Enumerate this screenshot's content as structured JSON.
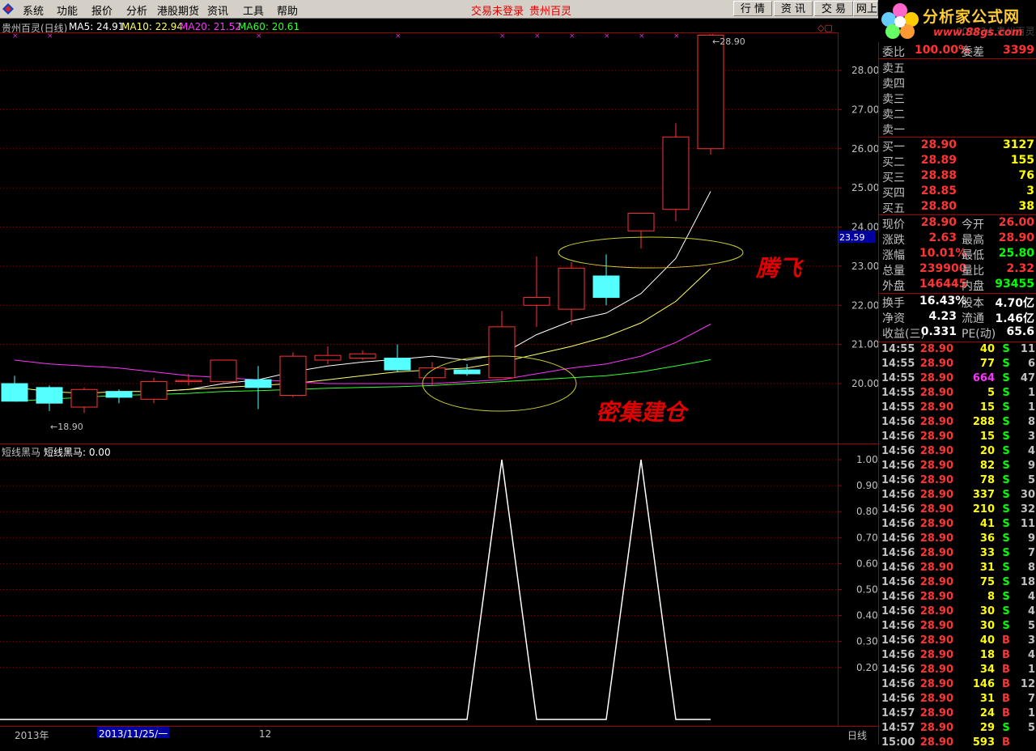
{
  "menu": {
    "items": [
      "系统",
      "功能",
      "报价",
      "分析",
      "港股期货",
      "资讯",
      "工具",
      "帮助"
    ],
    "status_login": "交易未登录",
    "status_stock": "贵州百灵",
    "buttons": [
      "行 情",
      "资 讯",
      "交 易",
      "网上"
    ]
  },
  "brand": {
    "title": "分析家公式网",
    "url": "www.88gs.com",
    "behind_text": "002424 贵州百灵"
  },
  "legend": {
    "name": "贵州百灵(日线)",
    "ma5": "MA5: 24.91",
    "ma10": "MA10: 22.94",
    "ma20": "MA20: 21.52",
    "ma60": "MA60: 20.61",
    "ma5_color": "#ffffff",
    "ma10_color": "#ffff66",
    "ma20_color": "#ff33ff",
    "ma60_color": "#33ff33"
  },
  "indicator": {
    "name": "短线黑马",
    "value_text": "短线黑马: 0.00"
  },
  "price_axis": {
    "ticks": [
      "28.00",
      "27.00",
      "26.00",
      "25.00",
      "24.00",
      "23.00",
      "22.00",
      "21.00",
      "20.00"
    ],
    "current_label": "23.59"
  },
  "indicator_axis": {
    "ticks": [
      "1.00",
      "0.90",
      "0.80",
      "0.70",
      "0.60",
      "0.50",
      "0.40",
      "0.30",
      "0.20"
    ]
  },
  "chart_annotations": {
    "high_label": "28.90",
    "low_label": "18.90",
    "tengfei": "腾飞",
    "mijijiancang": "密集建仓"
  },
  "chart_data": [
    {
      "type": "candlestick",
      "title": "贵州百灵(日线)",
      "ylim": [
        18.9,
        28.9
      ],
      "candles": [
        {
          "o": 20.0,
          "h": 20.2,
          "l": 19.55,
          "c": 19.55
        },
        {
          "o": 19.9,
          "h": 19.95,
          "l": 19.3,
          "c": 19.5
        },
        {
          "o": 19.4,
          "h": 19.9,
          "l": 19.25,
          "c": 19.85
        },
        {
          "o": 19.8,
          "h": 19.85,
          "l": 19.5,
          "c": 19.65
        },
        {
          "o": 19.6,
          "h": 20.15,
          "l": 19.5,
          "c": 20.05
        },
        {
          "o": 20.05,
          "h": 20.25,
          "l": 19.95,
          "c": 20.08
        },
        {
          "o": 20.05,
          "h": 20.6,
          "l": 20.0,
          "c": 20.6
        },
        {
          "o": 20.1,
          "h": 20.45,
          "l": 19.35,
          "c": 19.9
        },
        {
          "o": 19.7,
          "h": 20.8,
          "l": 19.65,
          "c": 20.7
        },
        {
          "o": 20.6,
          "h": 20.95,
          "l": 20.5,
          "c": 20.72
        },
        {
          "o": 20.65,
          "h": 20.85,
          "l": 20.6,
          "c": 20.76
        },
        {
          "o": 20.65,
          "h": 21.0,
          "l": 20.3,
          "c": 20.35
        },
        {
          "o": 20.15,
          "h": 20.55,
          "l": 19.95,
          "c": 20.4
        },
        {
          "o": 20.35,
          "h": 20.5,
          "l": 20.2,
          "c": 20.25
        },
        {
          "o": 20.15,
          "h": 21.85,
          "l": 20.15,
          "c": 21.45
        },
        {
          "o": 22.0,
          "h": 23.25,
          "l": 21.45,
          "c": 22.2
        },
        {
          "o": 21.9,
          "h": 23.1,
          "l": 21.5,
          "c": 22.95
        },
        {
          "o": 22.75,
          "h": 23.3,
          "l": 22.0,
          "c": 22.2
        },
        {
          "o": 23.9,
          "h": 24.35,
          "l": 23.45,
          "c": 24.35
        },
        {
          "o": 24.45,
          "h": 26.65,
          "l": 24.15,
          "c": 26.3
        },
        {
          "o": 26.0,
          "h": 28.9,
          "l": 25.85,
          "c": 28.9
        }
      ],
      "series": [
        {
          "name": "MA5",
          "values": [
            null,
            null,
            null,
            null,
            19.8,
            19.85,
            20.0,
            20.1,
            20.3,
            20.45,
            20.55,
            20.62,
            20.7,
            20.6,
            20.75,
            21.25,
            21.6,
            21.8,
            22.3,
            23.2,
            24.91
          ]
        },
        {
          "name": "MA10",
          "values": [
            19.9,
            19.8,
            19.75,
            19.8,
            19.8,
            19.85,
            19.9,
            19.95,
            20.0,
            20.1,
            20.2,
            20.3,
            20.35,
            20.4,
            20.55,
            20.75,
            20.95,
            21.2,
            21.55,
            22.1,
            22.94
          ]
        },
        {
          "name": "MA20",
          "values": [
            20.6,
            20.5,
            20.45,
            20.4,
            20.3,
            20.2,
            20.15,
            20.1,
            20.05,
            20.0,
            20.0,
            20.0,
            20.0,
            20.05,
            20.1,
            20.25,
            20.4,
            20.5,
            20.7,
            21.05,
            21.52
          ]
        },
        {
          "name": "MA60",
          "values": [
            19.55,
            19.6,
            19.65,
            19.7,
            19.72,
            19.75,
            19.8,
            19.82,
            19.85,
            19.88,
            19.9,
            19.92,
            19.95,
            20.0,
            20.05,
            20.1,
            20.15,
            20.2,
            20.3,
            20.45,
            20.61
          ]
        }
      ]
    },
    {
      "type": "line",
      "title": "短线黑马",
      "ylim": [
        0,
        1
      ],
      "series": [
        {
          "values": [
            0,
            0,
            0,
            0,
            0,
            0,
            0,
            0,
            0,
            0,
            0,
            0,
            0,
            0,
            1,
            0,
            0,
            0,
            1,
            0,
            0
          ]
        }
      ]
    }
  ],
  "bottom": {
    "year": "2013年",
    "date": "2013/11/25/一",
    "month": "12",
    "period": "日线"
  },
  "quote": {
    "weibi_label": "委比",
    "weibi_value": "100.00%",
    "weicha_label": "委差",
    "weicha_value": "3399",
    "sell": [
      {
        "label": "卖五",
        "price": "",
        "vol": ""
      },
      {
        "label": "卖四",
        "price": "",
        "vol": ""
      },
      {
        "label": "卖三",
        "price": "",
        "vol": ""
      },
      {
        "label": "卖二",
        "price": "",
        "vol": ""
      },
      {
        "label": "卖一",
        "price": "",
        "vol": ""
      }
    ],
    "buy": [
      {
        "label": "买一",
        "price": "28.90",
        "vol": "3127"
      },
      {
        "label": "买二",
        "price": "28.89",
        "vol": "155"
      },
      {
        "label": "买三",
        "price": "28.88",
        "vol": "76"
      },
      {
        "label": "买四",
        "price": "28.85",
        "vol": "3"
      },
      {
        "label": "买五",
        "price": "28.80",
        "vol": "38"
      }
    ],
    "stats": [
      {
        "l1": "现价",
        "v1": "28.90",
        "l2": "今开",
        "v2": "26.00",
        "c2": "#ff3333"
      },
      {
        "l1": "涨跌",
        "v1": "2.63",
        "l2": "最高",
        "v2": "28.90",
        "c2": "#ff3333"
      },
      {
        "l1": "涨幅",
        "v1": "10.01%",
        "l2": "最低",
        "v2": "25.80",
        "c2": "#00ff00"
      },
      {
        "l1": "总量",
        "v1": "239900",
        "l2": "量比",
        "v2": "2.32",
        "c2": "#ff3333"
      },
      {
        "l1": "外盘",
        "v1": "146445",
        "l2": "内盘",
        "v2": "93455",
        "c2": "#00ff00"
      }
    ],
    "stats2": [
      {
        "l1": "换手",
        "v1": "16.43%",
        "l2": "股本",
        "v2": "4.70亿"
      },
      {
        "l1": "净资",
        "v1": "4.23",
        "l2": "流通",
        "v2": "1.46亿"
      },
      {
        "l1": "收益(三)",
        "v1": "0.331",
        "l2": "PE(动)",
        "v2": "65.6"
      }
    ],
    "ticks": [
      {
        "t": "14:55",
        "p": "28.90",
        "v": "40",
        "bs": "S",
        "n": "11"
      },
      {
        "t": "14:55",
        "p": "28.90",
        "v": "77",
        "bs": "S",
        "n": "6"
      },
      {
        "t": "14:55",
        "p": "28.90",
        "v": "664",
        "bs": "S",
        "n": "47"
      },
      {
        "t": "14:55",
        "p": "28.90",
        "v": "5",
        "bs": "S",
        "n": "1"
      },
      {
        "t": "14:55",
        "p": "28.90",
        "v": "15",
        "bs": "S",
        "n": "1"
      },
      {
        "t": "14:56",
        "p": "28.90",
        "v": "288",
        "bs": "S",
        "n": "8"
      },
      {
        "t": "14:56",
        "p": "28.90",
        "v": "15",
        "bs": "S",
        "n": "3"
      },
      {
        "t": "14:56",
        "p": "28.90",
        "v": "20",
        "bs": "S",
        "n": "4"
      },
      {
        "t": "14:56",
        "p": "28.90",
        "v": "82",
        "bs": "S",
        "n": "9"
      },
      {
        "t": "14:56",
        "p": "28.90",
        "v": "78",
        "bs": "S",
        "n": "5"
      },
      {
        "t": "14:56",
        "p": "28.90",
        "v": "337",
        "bs": "S",
        "n": "30"
      },
      {
        "t": "14:56",
        "p": "28.90",
        "v": "210",
        "bs": "S",
        "n": "32"
      },
      {
        "t": "14:56",
        "p": "28.90",
        "v": "41",
        "bs": "S",
        "n": "11"
      },
      {
        "t": "14:56",
        "p": "28.90",
        "v": "36",
        "bs": "S",
        "n": "9"
      },
      {
        "t": "14:56",
        "p": "28.90",
        "v": "33",
        "bs": "S",
        "n": "7"
      },
      {
        "t": "14:56",
        "p": "28.90",
        "v": "31",
        "bs": "S",
        "n": "8"
      },
      {
        "t": "14:56",
        "p": "28.90",
        "v": "75",
        "bs": "S",
        "n": "18"
      },
      {
        "t": "14:56",
        "p": "28.90",
        "v": "8",
        "bs": "S",
        "n": "4"
      },
      {
        "t": "14:56",
        "p": "28.90",
        "v": "30",
        "bs": "S",
        "n": "4"
      },
      {
        "t": "14:56",
        "p": "28.90",
        "v": "30",
        "bs": "S",
        "n": "5"
      },
      {
        "t": "14:56",
        "p": "28.90",
        "v": "40",
        "bs": "B",
        "n": "3"
      },
      {
        "t": "14:56",
        "p": "28.90",
        "v": "18",
        "bs": "B",
        "n": "4"
      },
      {
        "t": "14:56",
        "p": "28.90",
        "v": "34",
        "bs": "B",
        "n": "1"
      },
      {
        "t": "14:56",
        "p": "28.90",
        "v": "146",
        "bs": "B",
        "n": "12"
      },
      {
        "t": "14:56",
        "p": "28.90",
        "v": "31",
        "bs": "B",
        "n": "7"
      },
      {
        "t": "14:57",
        "p": "28.90",
        "v": "24",
        "bs": "B",
        "n": "1"
      },
      {
        "t": "14:57",
        "p": "28.90",
        "v": "29",
        "bs": "S",
        "n": "5"
      },
      {
        "t": "15:00",
        "p": "28.90",
        "v": "593",
        "bs": "B",
        "n": ""
      }
    ]
  }
}
